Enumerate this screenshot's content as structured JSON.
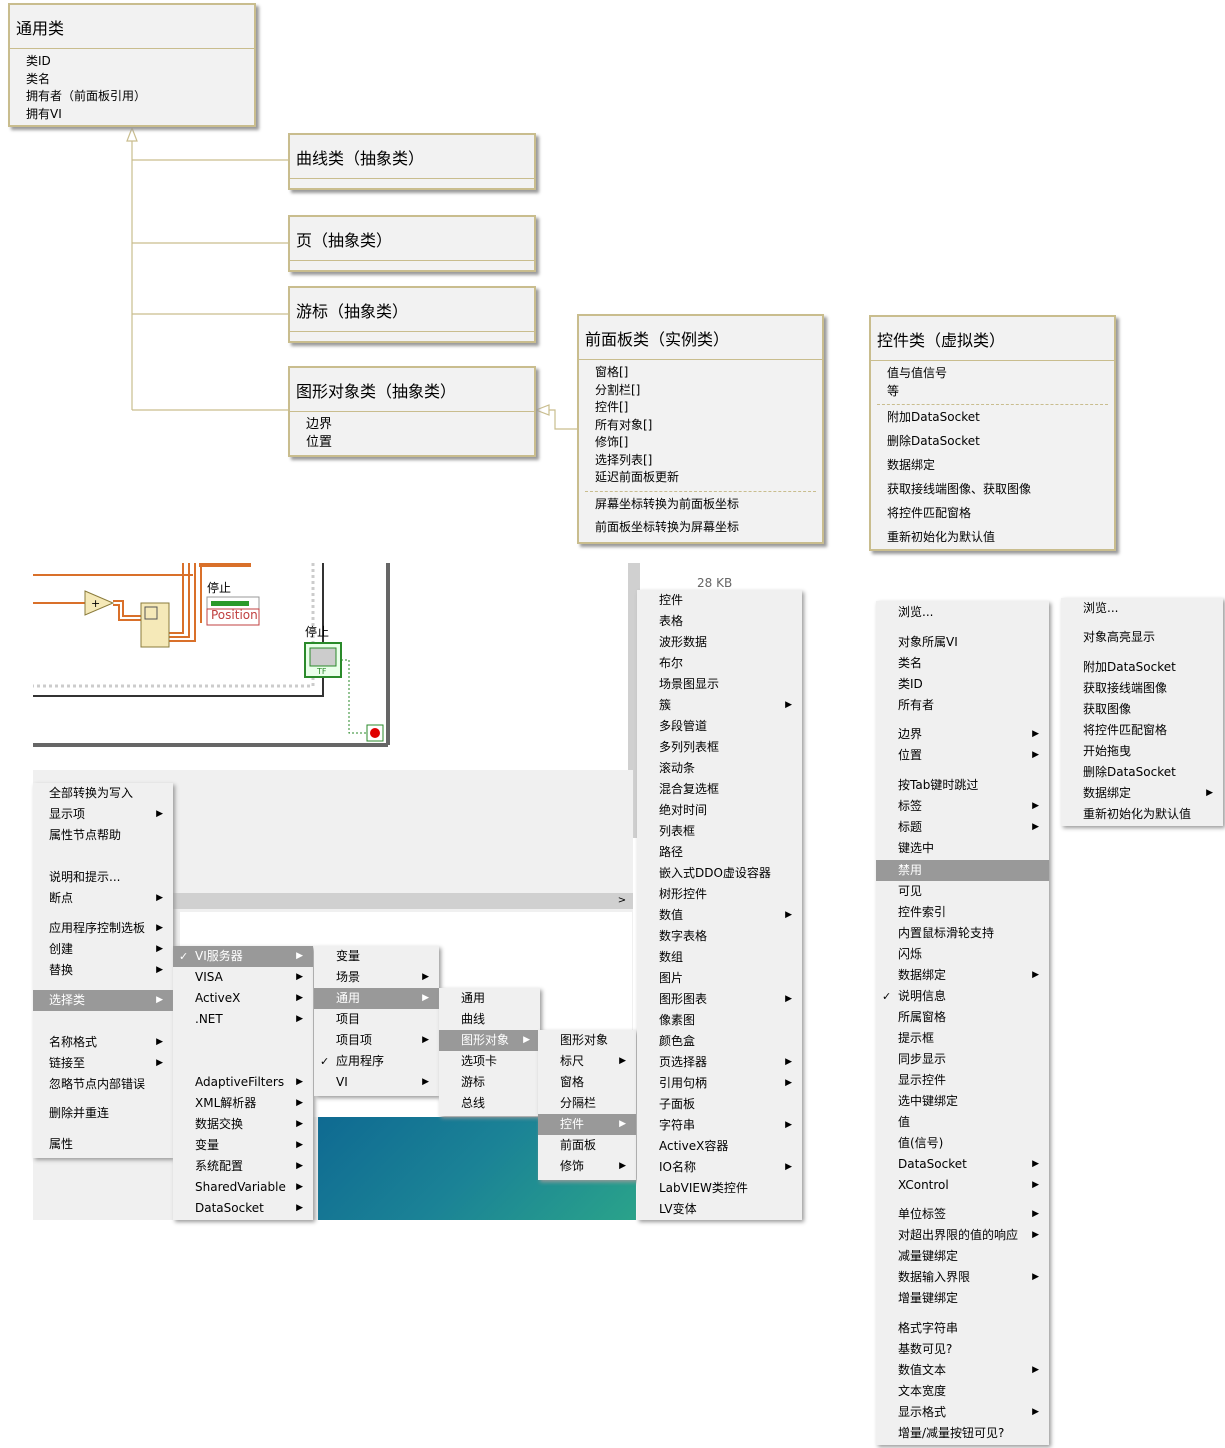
{
  "uml": {
    "general": {
      "title": "通用类",
      "attrs": [
        "类ID",
        "类名",
        "拥有者（前面板引用）",
        "拥有VI"
      ]
    },
    "curve": {
      "title": "曲线类（抽象类）"
    },
    "page": {
      "title": "页（抽象类）"
    },
    "cursor": {
      "title": "游标（抽象类）"
    },
    "graphic": {
      "title": "图形对象类（抽象类）",
      "attrs": [
        "边界",
        "位置"
      ]
    },
    "panel": {
      "title": "前面板类（实例类）",
      "attrs": [
        "窗格[]",
        "分割栏[]",
        "控件[]",
        "所有对象[]",
        "修饰[]",
        "选择列表[]",
        "延迟前面板更新"
      ],
      "methods": [
        "屏幕坐标转换为前面板坐标",
        "前面板坐标转换为屏幕坐标"
      ]
    },
    "control": {
      "title": "控件类（虚拟类）",
      "attrs": [
        "值与值信号",
        "等"
      ],
      "methods": [
        "附加DataSocket",
        "删除DataSocket",
        "数据绑定",
        "获取接线端图像、获取图像",
        "将控件匹配窗格",
        "重新初始化为默认值"
      ]
    }
  },
  "diagram": {
    "stop_label_1": "停止",
    "position_label": "Position",
    "stop_label_2": "停止",
    "tf_label": "TF",
    "file_size": "28 KB"
  },
  "menu1": [
    "全部转换为写入",
    "显示项",
    "属性节点帮助",
    "说明和提示...",
    "断点",
    "应用程序控制选板",
    "创建",
    "替换",
    "选择类",
    "名称格式",
    "链接至",
    "忽略节点内部错误",
    "删除并重连",
    "属性"
  ],
  "menu2": [
    "VI服务器",
    "VISA",
    "ActiveX",
    ".NET",
    "AdaptiveFilters",
    "XML解析器",
    "数据交换",
    "变量",
    "系统配置",
    "SharedVariable",
    "DataSocket"
  ],
  "menu3": [
    "变量",
    "场景",
    "通用",
    "项目",
    "项目项",
    "应用程序",
    "VI"
  ],
  "menu4": [
    "通用",
    "曲线",
    "图形对象",
    "选项卡",
    "游标",
    "总线"
  ],
  "menu5": [
    "图形对象",
    "标尺",
    "窗格",
    "分隔栏",
    "控件",
    "前面板",
    "修饰"
  ],
  "menu6": [
    "控件",
    "表格",
    "波形数据",
    "布尔",
    "场景图显示",
    "簇",
    "多段管道",
    "多列列表框",
    "滚动条",
    "混合复选框",
    "绝对时间",
    "列表框",
    "路径",
    "嵌入式DDO虚设容器",
    "树形控件",
    "数值",
    "数字表格",
    "数组",
    "图片",
    "图形图表",
    "像素图",
    "颜色盒",
    "页选择器",
    "引用句柄",
    "子面板",
    "字符串",
    "ActiveX容器",
    "IO名称",
    "LabVIEW类控件",
    "LV变体"
  ],
  "menu7": [
    "浏览...",
    "对象所属VI",
    "类名",
    "类ID",
    "所有者",
    "边界",
    "位置",
    "按Tab键时跳过",
    "标签",
    "标题",
    "键选中",
    "禁用",
    "可见",
    "控件索引",
    "内置鼠标滑轮支持",
    "闪烁",
    "数据绑定",
    "说明信息",
    "所属窗格",
    "提示框",
    "同步显示",
    "显示控件",
    "选中键绑定",
    "值",
    "值(信号)",
    "DataSocket",
    "XControl",
    "单位标签",
    "对超出界限的值的响应",
    "减量键绑定",
    "数据输入界限",
    "增量键绑定",
    "格式字符串",
    "基数可见?",
    "数值文本",
    "文本宽度",
    "显示格式",
    "增量/减量按钮可见?"
  ],
  "menu8": [
    "浏览...",
    "对象高亮显示",
    "附加DataSocket",
    "获取接线端图像",
    "获取图像",
    "将控件匹配窗格",
    "开始拖曳",
    "删除DataSocket",
    "数据绑定",
    "重新初始化为默认值"
  ],
  "colors": {
    "uml_border": "#c9bd8e",
    "menu_bg": "#f0f0f0",
    "menu_sel": "#999999",
    "wire_orange": "#d9702a",
    "teal_a": "#0f6a92",
    "teal_b": "#2aa38a"
  }
}
